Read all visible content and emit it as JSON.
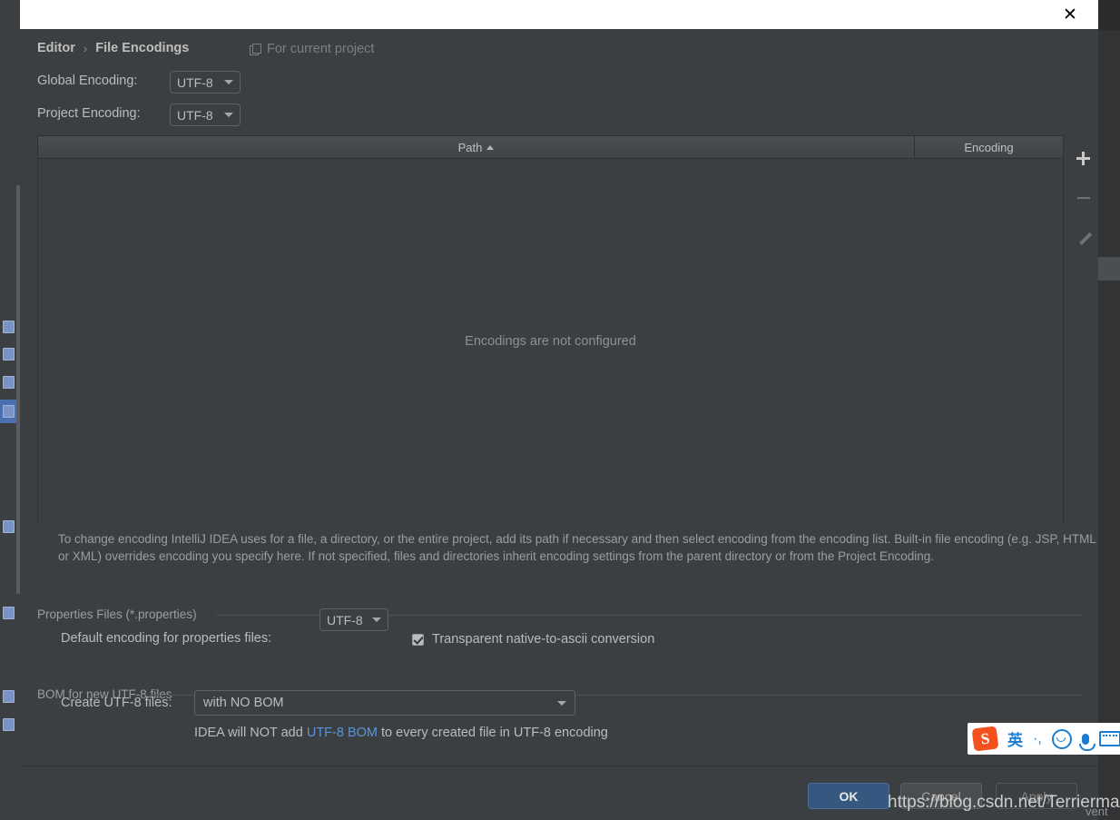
{
  "titlebar": {
    "close_icon": "close-icon"
  },
  "breadcrumb": {
    "parent": "Editor",
    "separator": "›",
    "current": "File Encodings"
  },
  "scope": {
    "icon": "copy-icon",
    "label": "For current project"
  },
  "encodings": {
    "global_label": "Global Encoding:",
    "global_value": "UTF-8",
    "project_label": "Project Encoding:",
    "project_value": "UTF-8"
  },
  "table": {
    "columns": [
      "Path",
      "Encoding"
    ],
    "sort_indicator": "▲",
    "rows": [],
    "empty_message": "Encodings are not configured",
    "tools": [
      {
        "name": "add-button",
        "icon": "plus-icon",
        "enabled": true
      },
      {
        "name": "remove-button",
        "icon": "minus-icon",
        "enabled": false
      },
      {
        "name": "edit-button",
        "icon": "pencil-icon",
        "enabled": false
      }
    ]
  },
  "help_text": "To change encoding IntelliJ IDEA uses for a file, a directory, or the entire project, add its path if necessary and then select encoding from the encoding list. Built-in file encoding (e.g. JSP, HTML or XML) overrides encoding you specify here. If not specified, files and directories inherit encoding settings from the parent directory or from the Project Encoding.",
  "properties_section": {
    "title": "Properties Files (*.properties)",
    "default_encoding_label": "Default encoding for properties files:",
    "default_encoding_value": "UTF-8",
    "checkbox_label": "Transparent native-to-ascii conversion",
    "checkbox_checked": true
  },
  "bom_section": {
    "title": "BOM for new UTF-8 files",
    "create_label": "Create UTF-8 files:",
    "create_value": "with NO BOM",
    "note_prefix": "IDEA will NOT add ",
    "note_link": "UTF-8 BOM",
    "note_suffix": " to every created file in UTF-8 encoding"
  },
  "ime": {
    "logo": "S",
    "language": "英",
    "punctuation": "·,",
    "emoji_icon": "smiley-icon",
    "mic_icon": "microphone-icon",
    "keyboard_icon": "keyboard-icon"
  },
  "buttons": {
    "ok": "OK",
    "cancel": "Cancel",
    "apply": "Apply"
  },
  "watermark": {
    "url": "https://blog.csdn.net/Terrierman",
    "tail": "vent"
  },
  "colors": {
    "dialog_bg": "#3c3f41",
    "accent_blue": "#365880",
    "link_blue": "#5a94d8",
    "ime_blue": "#1a7fd4",
    "ime_orange": "#f4511e"
  }
}
